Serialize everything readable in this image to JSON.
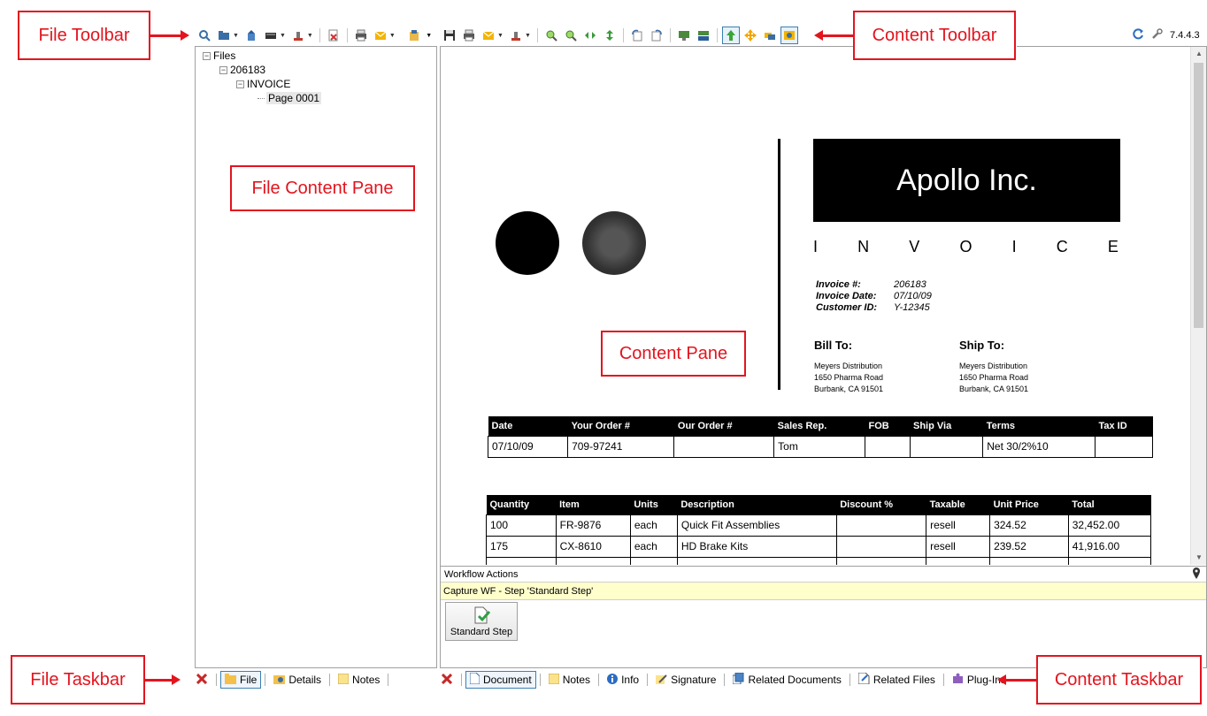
{
  "callouts": {
    "file_toolbar": "File Toolbar",
    "content_toolbar": "Content Toolbar",
    "file_content_pane": "File Content Pane",
    "content_pane": "Content Pane",
    "file_taskbar": "File Taskbar",
    "content_taskbar": "Content Taskbar"
  },
  "version": "7.4.4.3",
  "file_toolbar": {
    "icons": [
      "search-icon",
      "folder-icon",
      "upload-icon",
      "scanner-icon",
      "stamp-icon",
      "delete-icon",
      "print-icon",
      "email-icon",
      "archive-icon"
    ]
  },
  "content_toolbar": {
    "icons": [
      "save-icon",
      "print-icon",
      "email-icon",
      "stamp-icon",
      "zoom-in-icon",
      "zoom-out-icon",
      "fit-width-icon",
      "fit-height-icon",
      "rotate-left-icon",
      "rotate-right-icon",
      "thumbnail-icon",
      "split-view-icon",
      "route-up-icon",
      "move-icon",
      "annotate-icon",
      "redact-icon"
    ]
  },
  "tree": {
    "root": "Files",
    "file": "206183",
    "doc": "INVOICE",
    "page": "Page 0001"
  },
  "invoice": {
    "company": "Apollo Inc.",
    "title_letters": [
      "I",
      "N",
      "V",
      "O",
      "I",
      "C",
      "E"
    ],
    "meta": [
      {
        "label": "Invoice #:",
        "value": "206183"
      },
      {
        "label": "Invoice Date:",
        "value": "07/10/09"
      },
      {
        "label": "Customer ID:",
        "value": "Y-12345"
      }
    ],
    "bill_to_label": "Bill To:",
    "ship_to_label": "Ship To:",
    "bill_to": [
      "Meyers Distribution",
      "1650 Pharma Road",
      "Burbank, CA 91501"
    ],
    "ship_to": [
      "Meyers Distribution",
      "1650 Pharma Road",
      "Burbank, CA 91501"
    ],
    "order_table": {
      "headers": [
        "Date",
        "Your Order #",
        "Our Order #",
        "Sales Rep.",
        "FOB",
        "Ship Via",
        "Terms",
        "Tax ID"
      ],
      "rows": [
        [
          "07/10/09",
          "709-97241",
          "",
          "Tom",
          "",
          "",
          "Net 30/2%10",
          ""
        ]
      ]
    },
    "items_table": {
      "headers": [
        "Quantity",
        "Item",
        "Units",
        "Description",
        "Discount %",
        "Taxable",
        "Unit Price",
        "Total"
      ],
      "rows": [
        [
          "100",
          "FR-9876",
          "each",
          "Quick Fit Assemblies",
          "",
          "resell",
          "324.52",
          "32,452.00"
        ],
        [
          "175",
          "CX-8610",
          "each",
          "HD Brake Kits",
          "",
          "resell",
          "239.52",
          "41,916.00"
        ],
        [
          "",
          "",
          "",
          "",
          "",
          "",
          "",
          ""
        ]
      ]
    }
  },
  "workflow": {
    "header": "Workflow Actions",
    "step": "Capture WF - Step 'Standard Step'",
    "button": "Standard Step"
  },
  "file_taskbar": [
    "File",
    "Details",
    "Notes"
  ],
  "content_taskbar": [
    "Document",
    "Notes",
    "Info",
    "Signature",
    "Related Documents",
    "Related Files",
    "Plug-Ins"
  ]
}
